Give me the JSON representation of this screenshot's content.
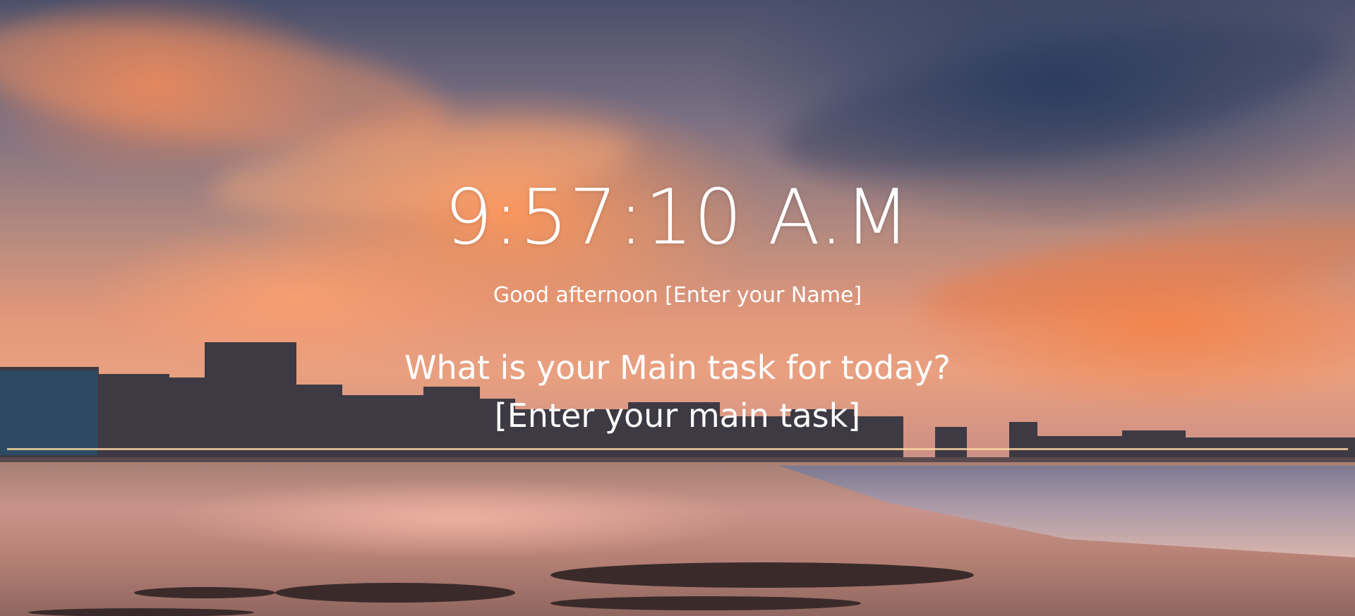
{
  "clock": {
    "time": "9:57:10 A.M"
  },
  "greeting": {
    "prefix": "Good afternoon",
    "name": "[Enter your Name]"
  },
  "focus": {
    "question": "What is your Main task for today?",
    "task": "[Enter your main task]"
  },
  "background": {
    "scene": "sunset-beach-city-skyline",
    "colors": {
      "sky_top": "#4a4f6a",
      "sky_glow": "#e9a080",
      "sand": "#c8938a",
      "text": "#ffffff"
    }
  }
}
